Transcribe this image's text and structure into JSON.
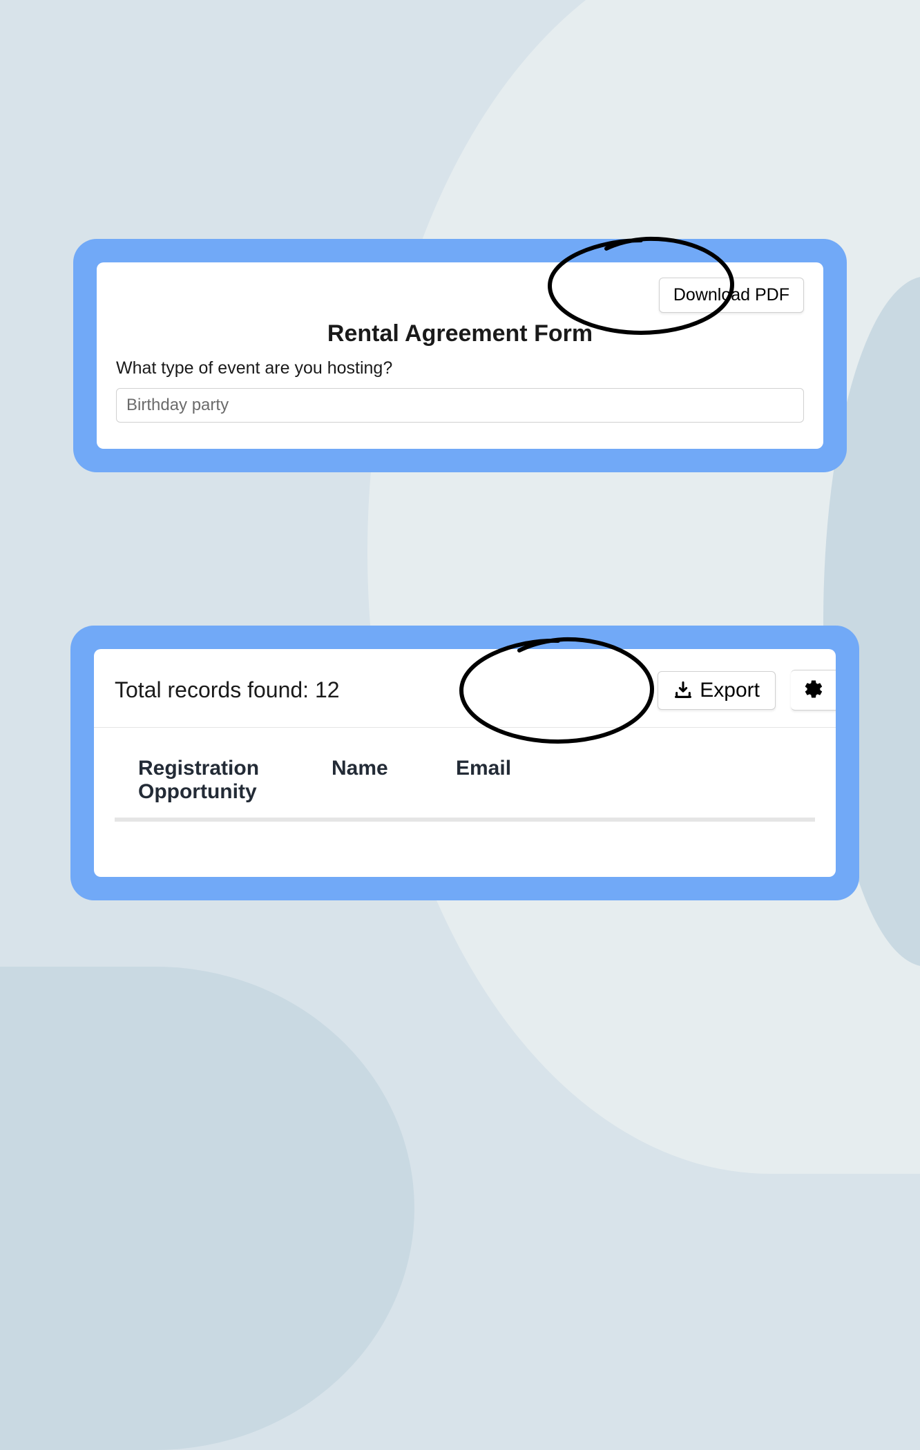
{
  "form_panel": {
    "download_button_label": "Download PDF",
    "title": "Rental Agreement Form",
    "question_label": "What type of event are you hosting?",
    "answer_value": "Birthday party"
  },
  "records_panel": {
    "total_label": "Total records found: 12",
    "export_button_label": "Export",
    "columns": {
      "registration": "Registration Opportunity",
      "name": "Name",
      "email": "Email"
    }
  }
}
